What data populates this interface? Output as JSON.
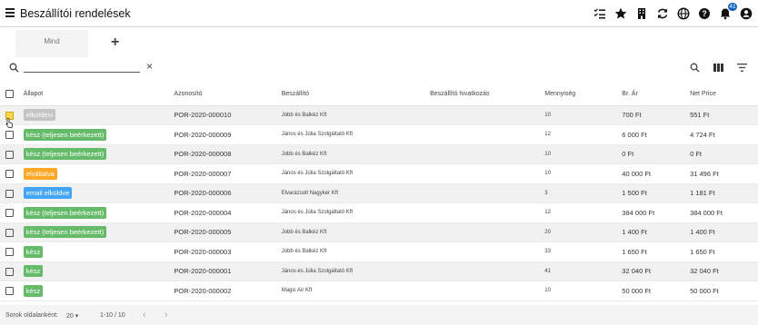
{
  "header": {
    "title": "Beszállítói rendelések",
    "notification_count": "41",
    "icons": [
      "format-list-checks-icon",
      "star-icon",
      "building-icon",
      "refresh-icon",
      "globe-icon",
      "help-icon",
      "bell-icon",
      "account-circle-icon"
    ]
  },
  "tabs": [
    {
      "label": "Mind"
    }
  ],
  "add_tab": "+",
  "search": {
    "value": "",
    "placeholder": "",
    "clear": "×"
  },
  "table": {
    "headers": {
      "status": "Állapot",
      "id": "Azonosító",
      "supplier": "Beszállító",
      "ref": "Beszállító hivatkozás",
      "qty": "Mennyiség",
      "gross": "Br. Ár",
      "net": "Net Price"
    },
    "rows": [
      {
        "status": "elküldeni",
        "status_color": "#c4c4c4",
        "id": "POR-2020-000010",
        "supplier": "Jobb és Balkéz Kft",
        "ref": "",
        "qty": "10",
        "gross": "700 Ft",
        "net": "551 Ft"
      },
      {
        "status": "kész (teljesen beérkezett)",
        "status_color": "#66bb6a",
        "id": "POR-2020-000009",
        "supplier": "János és Júlia Szolgáltató Kft",
        "ref": "",
        "qty": "12",
        "gross": "6 000 Ft",
        "net": "4 724 Ft"
      },
      {
        "status": "kész (teljesen beérkezett)",
        "status_color": "#66bb6a",
        "id": "POR-2020-000008",
        "supplier": "Jobb és Balkéz Kft",
        "ref": "",
        "qty": "10",
        "gross": "0 Ft",
        "net": "0 Ft"
      },
      {
        "status": "elvállalva",
        "status_color": "#ffa726",
        "id": "POR-2020-000007",
        "supplier": "János és Júlia Szolgáltató Kft",
        "ref": "",
        "qty": "10",
        "gross": "40 000 Ft",
        "net": "31 496 Ft"
      },
      {
        "status": "email elküldve",
        "status_color": "#42a5f5",
        "id": "POR-2020-000006",
        "supplier": "Elvarázsolt Nagyker Kft",
        "ref": "",
        "qty": "3",
        "gross": "1 500 Ft",
        "net": "1 181 Ft"
      },
      {
        "status": "kész (teljesen beérkezett)",
        "status_color": "#66bb6a",
        "id": "POR-2020-000004",
        "supplier": "János és Júlia Szolgáltató Kft",
        "ref": "",
        "qty": "12",
        "gross": "384 000 Ft",
        "net": "384 000 Ft"
      },
      {
        "status": "kész (teljesen beérkezett)",
        "status_color": "#66bb6a",
        "id": "POR-2020-000005",
        "supplier": "Jobb és Balkéz Kft",
        "ref": "",
        "qty": "20",
        "gross": "1 400 Ft",
        "net": "1 400 Ft"
      },
      {
        "status": "kész",
        "status_color": "#66bb6a",
        "id": "POR-2020-000003",
        "supplier": "Jobb és Balkéz Kft",
        "ref": "",
        "qty": "33",
        "gross": "1 650 Ft",
        "net": "1 650 Ft"
      },
      {
        "status": "kész",
        "status_color": "#66bb6a",
        "id": "POR-2020-000001",
        "supplier": "János és Júlia Szolgáltató Kft",
        "ref": "",
        "qty": "41",
        "gross": "32 040 Ft",
        "net": "32 040 Ft"
      },
      {
        "status": "kész",
        "status_color": "#66bb6a",
        "id": "POR-2020-000002",
        "supplier": "Magic Air Kft",
        "ref": "",
        "qty": "10",
        "gross": "50 000 Ft",
        "net": "50 000 Ft"
      }
    ]
  },
  "pagination": {
    "rows_per_page_label": "Sorok oldalanként:",
    "rows_per_page": "20",
    "range": "1-10 / 10",
    "prev": "‹",
    "next": "›"
  }
}
